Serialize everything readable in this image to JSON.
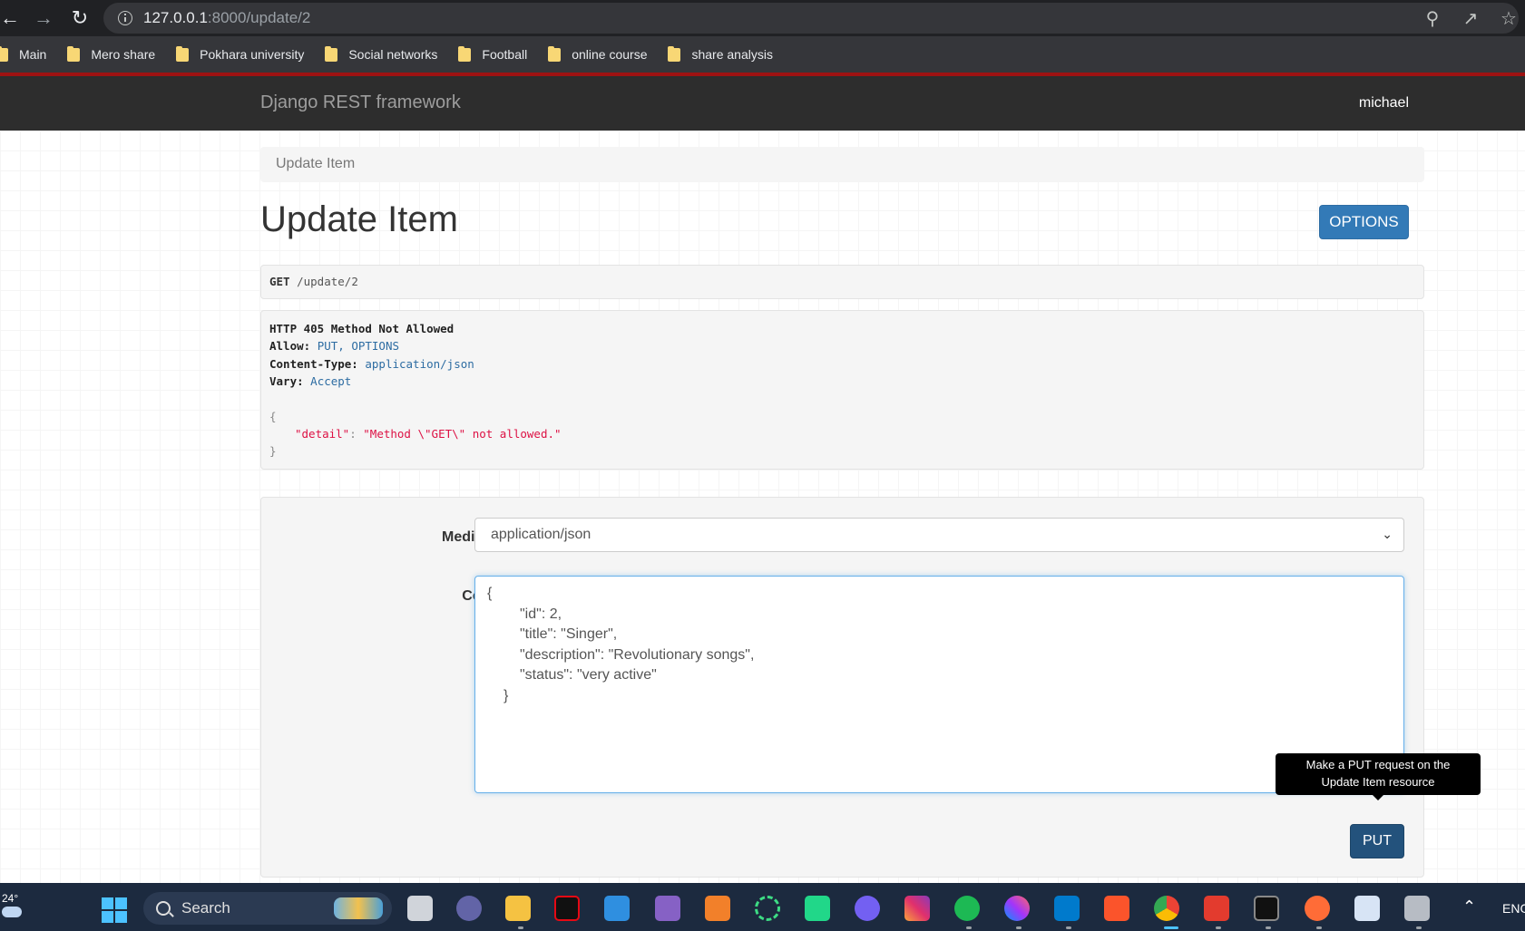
{
  "browser": {
    "url_host": "127.0.0.1",
    "url_path": ":8000/update/2",
    "bookmarks": [
      "Main",
      "Mero share",
      "Pokhara university",
      "Social networks",
      "Football",
      "online course",
      "share analysis"
    ]
  },
  "navbar": {
    "brand": "Django REST framework",
    "user": "michael"
  },
  "breadcrumb": "Update Item",
  "page_title": "Update Item",
  "options_label": "OPTIONS",
  "request": {
    "method": "GET",
    "path": "/update/2"
  },
  "response": {
    "status": "HTTP 405 Method Not Allowed",
    "allow_key": "Allow:",
    "allow_val": "PUT, OPTIONS",
    "ctype_key": "Content-Type:",
    "ctype_val": "application/json",
    "vary_key": "Vary:",
    "vary_val": "Accept",
    "open_brace": "{",
    "detail_key": "\"detail\"",
    "detail_val": "\"Method \\\"GET\\\" not allowed.\"",
    "close_brace": "}"
  },
  "form": {
    "media_label": "Media type:",
    "media_value": "application/json",
    "content_label": "Content:",
    "content_lines": [
      "{",
      "\"id\": 2,",
      "\"title\": \"Singer\",",
      "\"description\": \"Revolutionary songs\",",
      "\"status\": \"very active\"",
      "}"
    ],
    "put_label": "PUT",
    "tooltip_line1": "Make a PUT request on the",
    "tooltip_line2": "Update Item resource"
  },
  "taskbar": {
    "temperature": "24°",
    "search_label": "Search",
    "lang": "ENG"
  },
  "colors": {
    "primary": "#337ab7",
    "navbar": "#2d2d2d",
    "accent_red": "#9e1212",
    "taskbar": "#1c2a3f"
  }
}
